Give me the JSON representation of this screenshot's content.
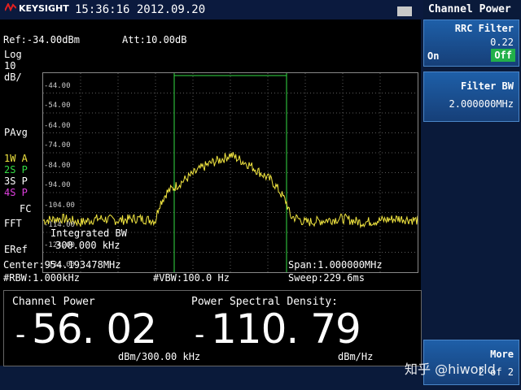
{
  "header": {
    "brand": "KEYSIGHT",
    "datetime": "15:36:16 2012.09.20"
  },
  "screen": {
    "ref": "Ref:-34.00dBm",
    "att": "Att:10.00dB",
    "scale_type": "Log",
    "scale_value": "10",
    "scale_unit": "dB/",
    "detector": "PAvg",
    "traces": [
      {
        "label": "1W",
        "mode": "A",
        "color": "#f2e640"
      },
      {
        "label": "2S",
        "mode": "P",
        "color": "#33dd44"
      },
      {
        "label": "3S",
        "mode": "P",
        "color": "#ffffff"
      },
      {
        "label": "4S",
        "mode": "P",
        "color": "#e040e0"
      }
    ],
    "fc": "FC",
    "fft": "FFT",
    "eref": "ERef",
    "integrated_bw_label": "Integrated BW",
    "integrated_bw_value": "300.000 kHz",
    "center": "Center:954.193478MHz",
    "span": "Span:1.000000MHz",
    "rbw": "#RBW:1.000kHz",
    "vbw": "#VBW:100.0 Hz",
    "sweep": "Sweep:229.6ms"
  },
  "chart_data": {
    "type": "line",
    "ylim": [
      -134,
      -34
    ],
    "y_ticks": [
      "-44.00",
      "-54.00",
      "-64.00",
      "-74.00",
      "-84.00",
      "-94.00",
      "-104.00",
      "-114.00",
      "-124.00",
      "-134.00"
    ],
    "x_range_mhz": [
      953.693478,
      954.693478
    ],
    "integration_band_mhz": [
      954.043478,
      954.343478
    ],
    "series": [
      {
        "color": "#f2e640",
        "x_frac": [
          0,
          0.05,
          0.1,
          0.15,
          0.2,
          0.25,
          0.3,
          0.31,
          0.33,
          0.36,
          0.39,
          0.42,
          0.45,
          0.48,
          0.5,
          0.52,
          0.55,
          0.58,
          0.61,
          0.63,
          0.65,
          0.66,
          0.68,
          0.7,
          0.75,
          0.8,
          0.85,
          0.9,
          0.95,
          1.0
        ],
        "y": [
          -108,
          -107,
          -109,
          -107,
          -108,
          -107,
          -108,
          -100,
          -94,
          -90,
          -86,
          -82,
          -79,
          -77,
          -75,
          -77,
          -80,
          -84,
          -88,
          -93,
          -99,
          -106,
          -107,
          -109,
          -108,
          -107,
          -109,
          -108,
          -107,
          -108
        ]
      }
    ]
  },
  "measurement": {
    "channel_power_label": "Channel Power",
    "channel_power_sign": "-",
    "channel_power_value": "56. 02",
    "channel_power_unit": "dBm/300.00 kHz",
    "psd_label": "Power Spectral Density:",
    "psd_sign": "-",
    "psd_value": "110. 79",
    "psd_unit": "dBm/Hz"
  },
  "softkeys": {
    "panel_title": "Channel Power",
    "rrc_filter_label": "RRC Filter",
    "rrc_filter_value": "0.22",
    "rrc_on": "On",
    "rrc_off": "Off",
    "filter_bw_label": "Filter BW",
    "filter_bw_value": "2.000000MHz",
    "more_label": "More",
    "more_page": "2 of 2"
  },
  "watermark": "知乎 @hiworld"
}
